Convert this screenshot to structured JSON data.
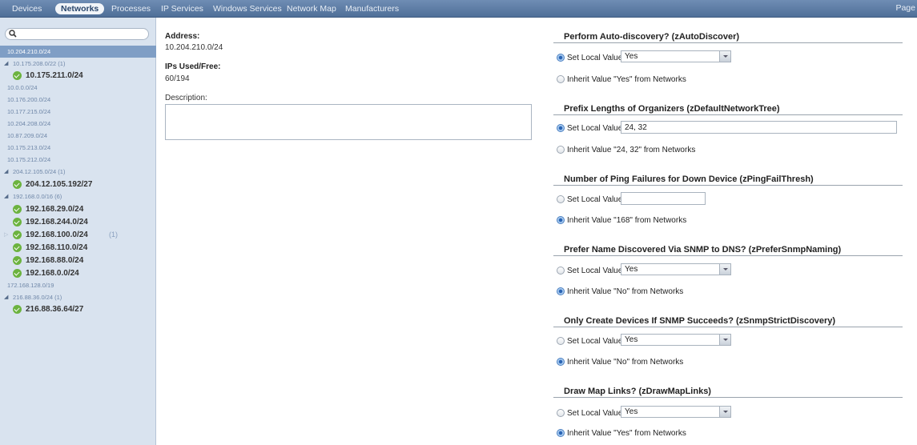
{
  "nav": {
    "tabs": [
      "Devices",
      "Networks",
      "Processes",
      "IP Services",
      "Windows Services",
      "Network Map",
      "Manufacturers"
    ],
    "active": "Networks",
    "right_text": "Page"
  },
  "sidebar": {
    "search_placeholder": "",
    "tree": [
      {
        "label": "10.204.210.0/24",
        "selected": true
      },
      {
        "label": "10.175.208.0/22 (1)",
        "expanded": true
      },
      {
        "label": "10.175.211.0/24",
        "status": "ok"
      },
      {
        "label": "10.0.0.0/24"
      },
      {
        "label": "10.176.200.0/24"
      },
      {
        "label": "10.177.215.0/24"
      },
      {
        "label": "10.204.208.0/24"
      },
      {
        "label": "10.87.209.0/24"
      },
      {
        "label": "10.175.213.0/24"
      },
      {
        "label": "10.175.212.0/24"
      },
      {
        "label": "204.12.105.0/24 (1)",
        "expanded": true
      },
      {
        "label": "204.12.105.192/27",
        "status": "ok"
      },
      {
        "label": "192.168.0.0/16 (6)",
        "expanded": true
      },
      {
        "label": "192.168.29.0/24",
        "status": "ok"
      },
      {
        "label": "192.168.244.0/24",
        "status": "ok"
      },
      {
        "label": "192.168.100.0/24",
        "count": "(1)",
        "status": "ok",
        "collapsed": true
      },
      {
        "label": "192.168.110.0/24",
        "status": "ok"
      },
      {
        "label": "192.168.88.0/24",
        "status": "ok"
      },
      {
        "label": "192.168.0.0/24",
        "status": "ok"
      },
      {
        "label": "172.168.128.0/19"
      },
      {
        "label": "216.88.36.0/24 (1)",
        "expanded": true
      },
      {
        "label": "216.88.36.64/27",
        "status": "ok"
      }
    ]
  },
  "details": {
    "address_label": "Address:",
    "address_value": "10.204.210.0/24",
    "ips_label": "IPs Used/Free:",
    "ips_value": "60/194",
    "description_label": "Description:",
    "description_value": ""
  },
  "properties": [
    {
      "title": "Perform Auto-discovery? (zAutoDiscover)",
      "set_label": "Set Local Value:",
      "control": "select",
      "value": "Yes",
      "selected": "set",
      "inherit_label": "Inherit Value \"Yes\" from Networks"
    },
    {
      "title": "Prefix Lengths of Organizers (zDefaultNetworkTree)",
      "set_label": "Set Local Value:",
      "control": "text-wide",
      "value": "24, 32",
      "selected": "set",
      "inherit_label": "Inherit Value \"24, 32\" from Networks"
    },
    {
      "title": "Number of Ping Failures for Down Device (zPingFailThresh)",
      "set_label": "Set Local Value:",
      "control": "text",
      "value": "",
      "selected": "inherit",
      "inherit_label": "Inherit Value \"168\" from Networks"
    },
    {
      "title": "Prefer Name Discovered Via SNMP to DNS? (zPreferSnmpNaming)",
      "set_label": "Set Local Value:",
      "control": "select",
      "value": "Yes",
      "selected": "inherit",
      "inherit_label": "Inherit Value \"No\" from Networks"
    },
    {
      "title": "Only Create Devices If SNMP Succeeds? (zSnmpStrictDiscovery)",
      "set_label": "Set Local Value:",
      "control": "select",
      "value": "Yes",
      "selected": "inherit",
      "inherit_label": "Inherit Value \"No\" from Networks"
    },
    {
      "title": "Draw Map Links? (zDrawMapLinks)",
      "set_label": "Set Local Value:",
      "control": "select",
      "value": "Yes",
      "selected": "inherit",
      "inherit_label": "Inherit Value \"Yes\" from Networks"
    }
  ]
}
